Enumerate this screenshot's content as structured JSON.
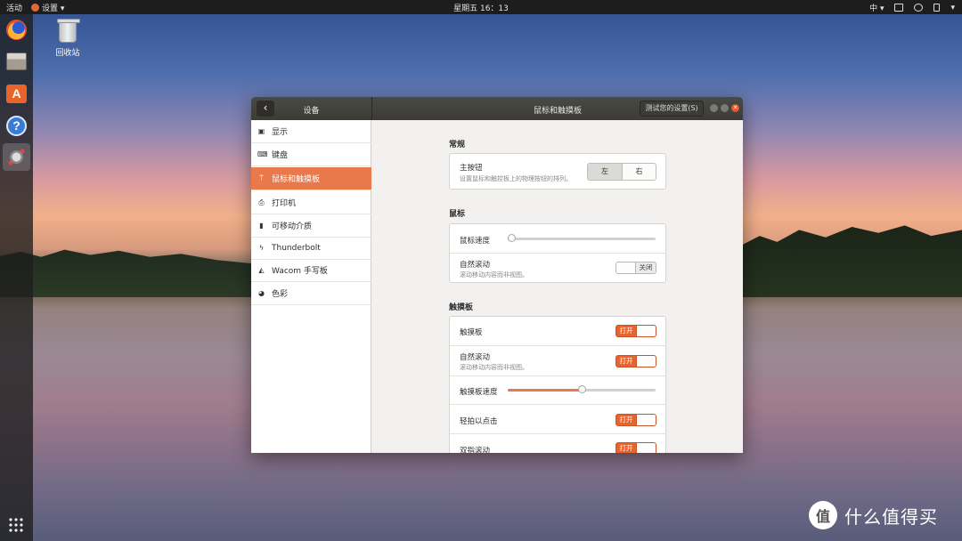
{
  "topbar": {
    "activities": "活动",
    "app_menu": "设置 ▾",
    "clock": "星期五 16：13",
    "input_method": "中 ▾"
  },
  "desktop": {
    "trash_label": "回收站"
  },
  "window": {
    "sidebar_title": "设备",
    "title": "鼠标和触摸板",
    "test_button": "测试您的设置(S)",
    "back_glyph": "‹",
    "close_glyph": "✕"
  },
  "sidebar": {
    "items": [
      {
        "label": "显示",
        "icon": "display-icon",
        "glyph": "▣"
      },
      {
        "label": "键盘",
        "icon": "keyboard-icon",
        "glyph": "⌨"
      },
      {
        "label": "鼠标和触摸板",
        "icon": "mouse-icon",
        "glyph": "⍑",
        "selected": true
      },
      {
        "label": "打印机",
        "icon": "printer-icon",
        "glyph": "⎙"
      },
      {
        "label": "可移动介质",
        "icon": "usb-icon",
        "glyph": "▮"
      },
      {
        "label": "Thunderbolt",
        "icon": "thunderbolt-icon",
        "glyph": "ϟ"
      },
      {
        "label": "Wacom 手写板",
        "icon": "tablet-icon",
        "glyph": "◭"
      },
      {
        "label": "色彩",
        "icon": "color-icon",
        "glyph": "◕"
      }
    ]
  },
  "general": {
    "title": "常规",
    "primary_button": {
      "label": "主按钮",
      "desc": "设置鼠标和触控板上的物理按钮的排列。",
      "left": "左",
      "right": "右",
      "selected": "左"
    }
  },
  "mouse": {
    "title": "鼠标",
    "speed_label": "鼠标速度",
    "speed_value": 0.0,
    "natural_scroll_label": "自然滚动",
    "natural_scroll_desc": "滚动移动内容而非视图。",
    "natural_scroll_state": "关闭"
  },
  "touchpad": {
    "title": "触摸板",
    "touchpad_label": "触摸板",
    "touchpad_state": "打开",
    "natural_scroll_label": "自然滚动",
    "natural_scroll_desc": "滚动移动内容而非视图。",
    "natural_scroll_state": "打开",
    "speed_label": "触摸板速度",
    "speed_value": 0.5,
    "tap_to_click_label": "轻拍以点击",
    "tap_to_click_state": "打开",
    "two_finger_label": "双指滚动",
    "two_finger_state": "打开"
  },
  "watermark": {
    "logo_glyph": "值",
    "text": "什么值得买"
  },
  "colors": {
    "accent": "#e9784a",
    "switch_on": "#e9642d",
    "headerbar": "#3c3b37",
    "close": "#e5572c"
  }
}
